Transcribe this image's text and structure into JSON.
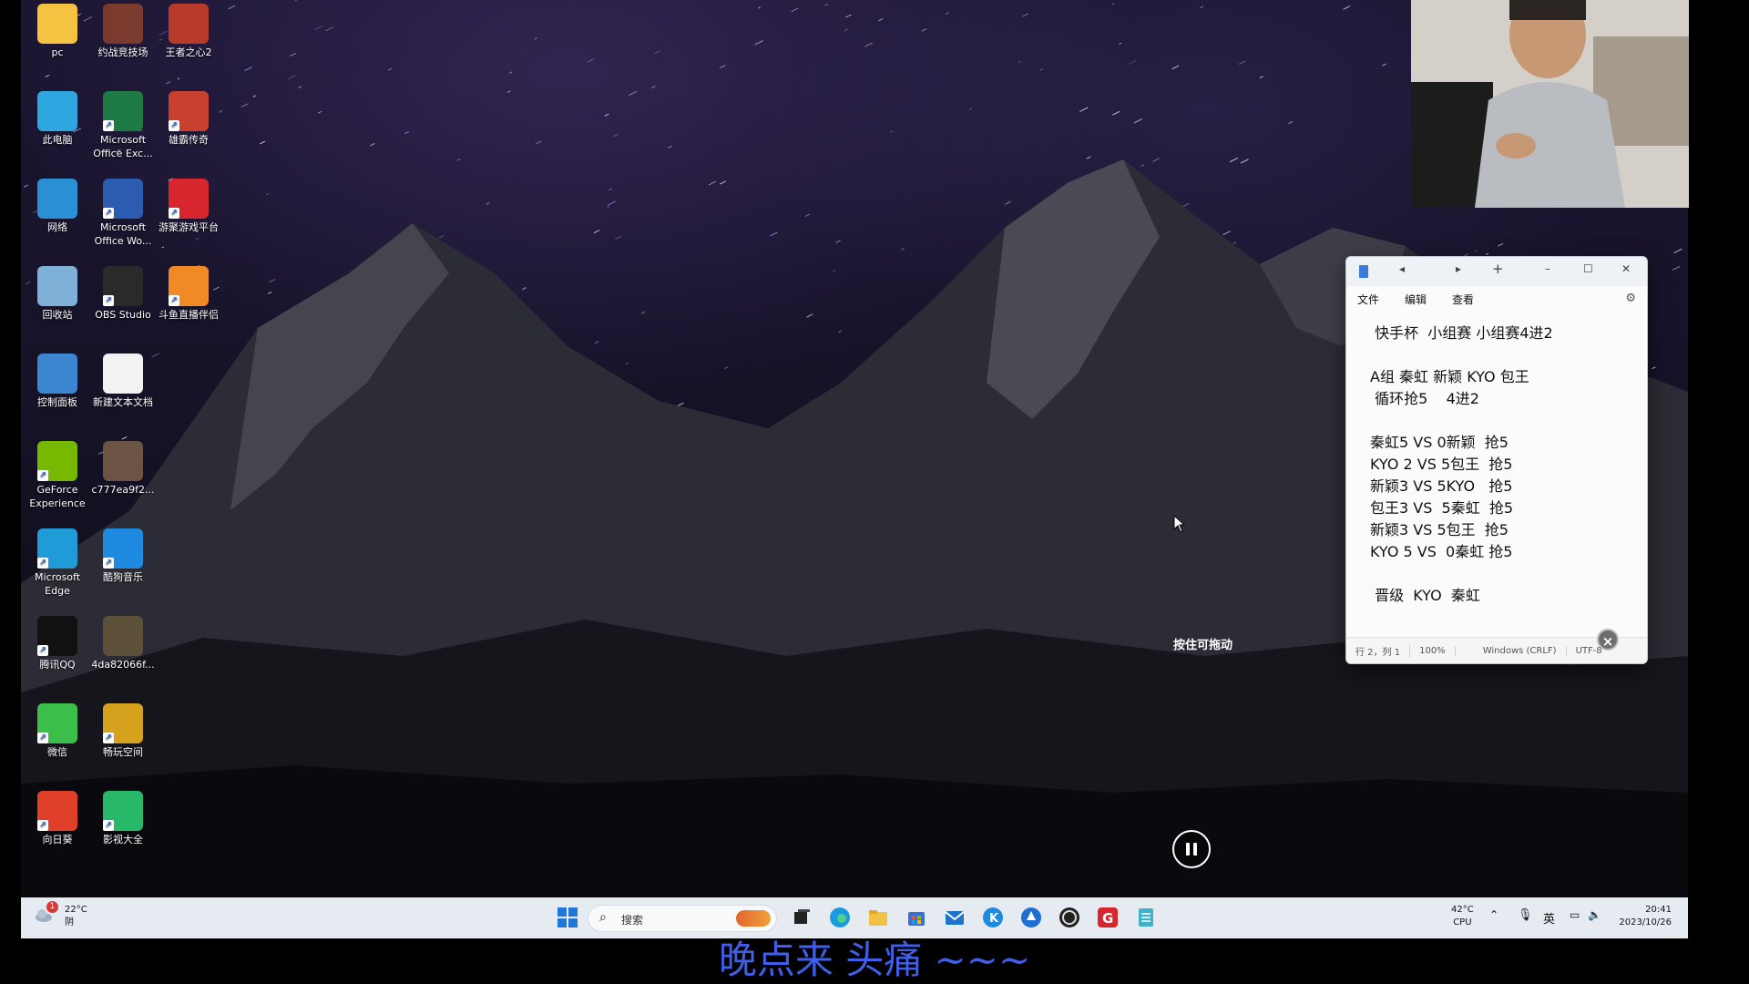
{
  "desktop_icons": [
    {
      "label": "pc",
      "icon": "folder-icon",
      "color": "#f5c242"
    },
    {
      "label": "约战竞技场",
      "icon": "game-icon",
      "color": "#7a3b2e"
    },
    {
      "label": "王者之心2",
      "icon": "game-icon",
      "color": "#b83a2a"
    },
    {
      "label": "此电脑",
      "icon": "monitor-icon",
      "color": "#2ea7e0"
    },
    {
      "label": "Microsoft Office Exc...",
      "icon": "excel-icon",
      "color": "#1d7a45"
    },
    {
      "label": "雄霸传奇",
      "icon": "game-icon",
      "color": "#c9402e"
    },
    {
      "label": "网络",
      "icon": "network-icon",
      "color": "#2b8fd6"
    },
    {
      "label": "Microsoft Office Wo...",
      "icon": "word-icon",
      "color": "#2b5caf"
    },
    {
      "label": "游聚游戏平台",
      "icon": "game-platform-icon",
      "color": "#d8262f"
    },
    {
      "label": "回收站",
      "icon": "recycle-bin-icon",
      "color": "#7fb0d8"
    },
    {
      "label": "OBS Studio",
      "icon": "obs-icon",
      "color": "#2a2a2a"
    },
    {
      "label": "斗鱼直播伴侣",
      "icon": "douyu-icon",
      "color": "#f08a24"
    },
    {
      "label": "控制面板",
      "icon": "control-panel-icon",
      "color": "#3b86cf"
    },
    {
      "label": "新建文本文档",
      "icon": "text-file-icon",
      "color": "#f2f2f2"
    },
    {
      "label": "GeForce Experience",
      "icon": "nvidia-icon",
      "color": "#76b900"
    },
    {
      "label": "c777ea9f2...",
      "icon": "image-file-icon",
      "color": "#6b5444"
    },
    {
      "label": "Microsoft Edge",
      "icon": "edge-icon",
      "color": "#1f9bd8"
    },
    {
      "label": "酷狗音乐",
      "icon": "kugou-icon",
      "color": "#1f8be0"
    },
    {
      "label": "腾讯QQ",
      "icon": "qq-icon",
      "color": "#111111"
    },
    {
      "label": "4da82066f...",
      "icon": "image-file-icon",
      "color": "#5c5038"
    },
    {
      "label": "微信",
      "icon": "wechat-icon",
      "color": "#3cbf4a"
    },
    {
      "label": "畅玩空间",
      "icon": "game-icon",
      "color": "#d6a21e"
    },
    {
      "label": "向日葵",
      "icon": "sunflower-icon",
      "color": "#e0402a"
    },
    {
      "label": "影视大全",
      "icon": "video-icon",
      "color": "#27b86a"
    }
  ],
  "notepad": {
    "menu": [
      "文件",
      "编辑",
      "查看"
    ],
    "lines": [
      " 快手杯  小组赛 小组赛4进2",
      "",
      "A组 秦虹 新颖 KYO 包王",
      " 循环抢5    4进2",
      "",
      "秦虹5 VS 0新颖  抢5",
      "KYO 2 VS 5包王  抢5",
      "新颖3 VS 5KYO   抢5",
      "包王3 VS  5秦虹  抢5",
      "新颖3 VS 5包王  抢5",
      "KYO 5 VS  0秦虹 抢5",
      "",
      " 晋级  KYO  秦虹"
    ],
    "status": {
      "position": "行 2，列 1",
      "zoom": "100%",
      "line_ending": "Windows (CRLF)",
      "encoding": "UTF-8"
    }
  },
  "overlay": {
    "drag_hint": "按住可拖动",
    "close_badge": "×"
  },
  "taskbar": {
    "weather_temp": "22°C",
    "weather_desc": "阴",
    "weather_badge": "1",
    "search_placeholder": "搜索",
    "cpu_temp": "42°C",
    "cpu_label": "CPU",
    "ime": "英",
    "time": "20:41",
    "date": "2023/10/26",
    "pinned_apps": [
      "start-icon",
      "task-view-icon",
      "edge-icon",
      "file-explorer-icon",
      "store-icon",
      "mail-icon",
      "kugou-icon",
      "app-icon",
      "obs-icon",
      "game-platform-icon",
      "notepad-icon"
    ]
  },
  "subtitle": "晚点来 头痛 ~~~"
}
